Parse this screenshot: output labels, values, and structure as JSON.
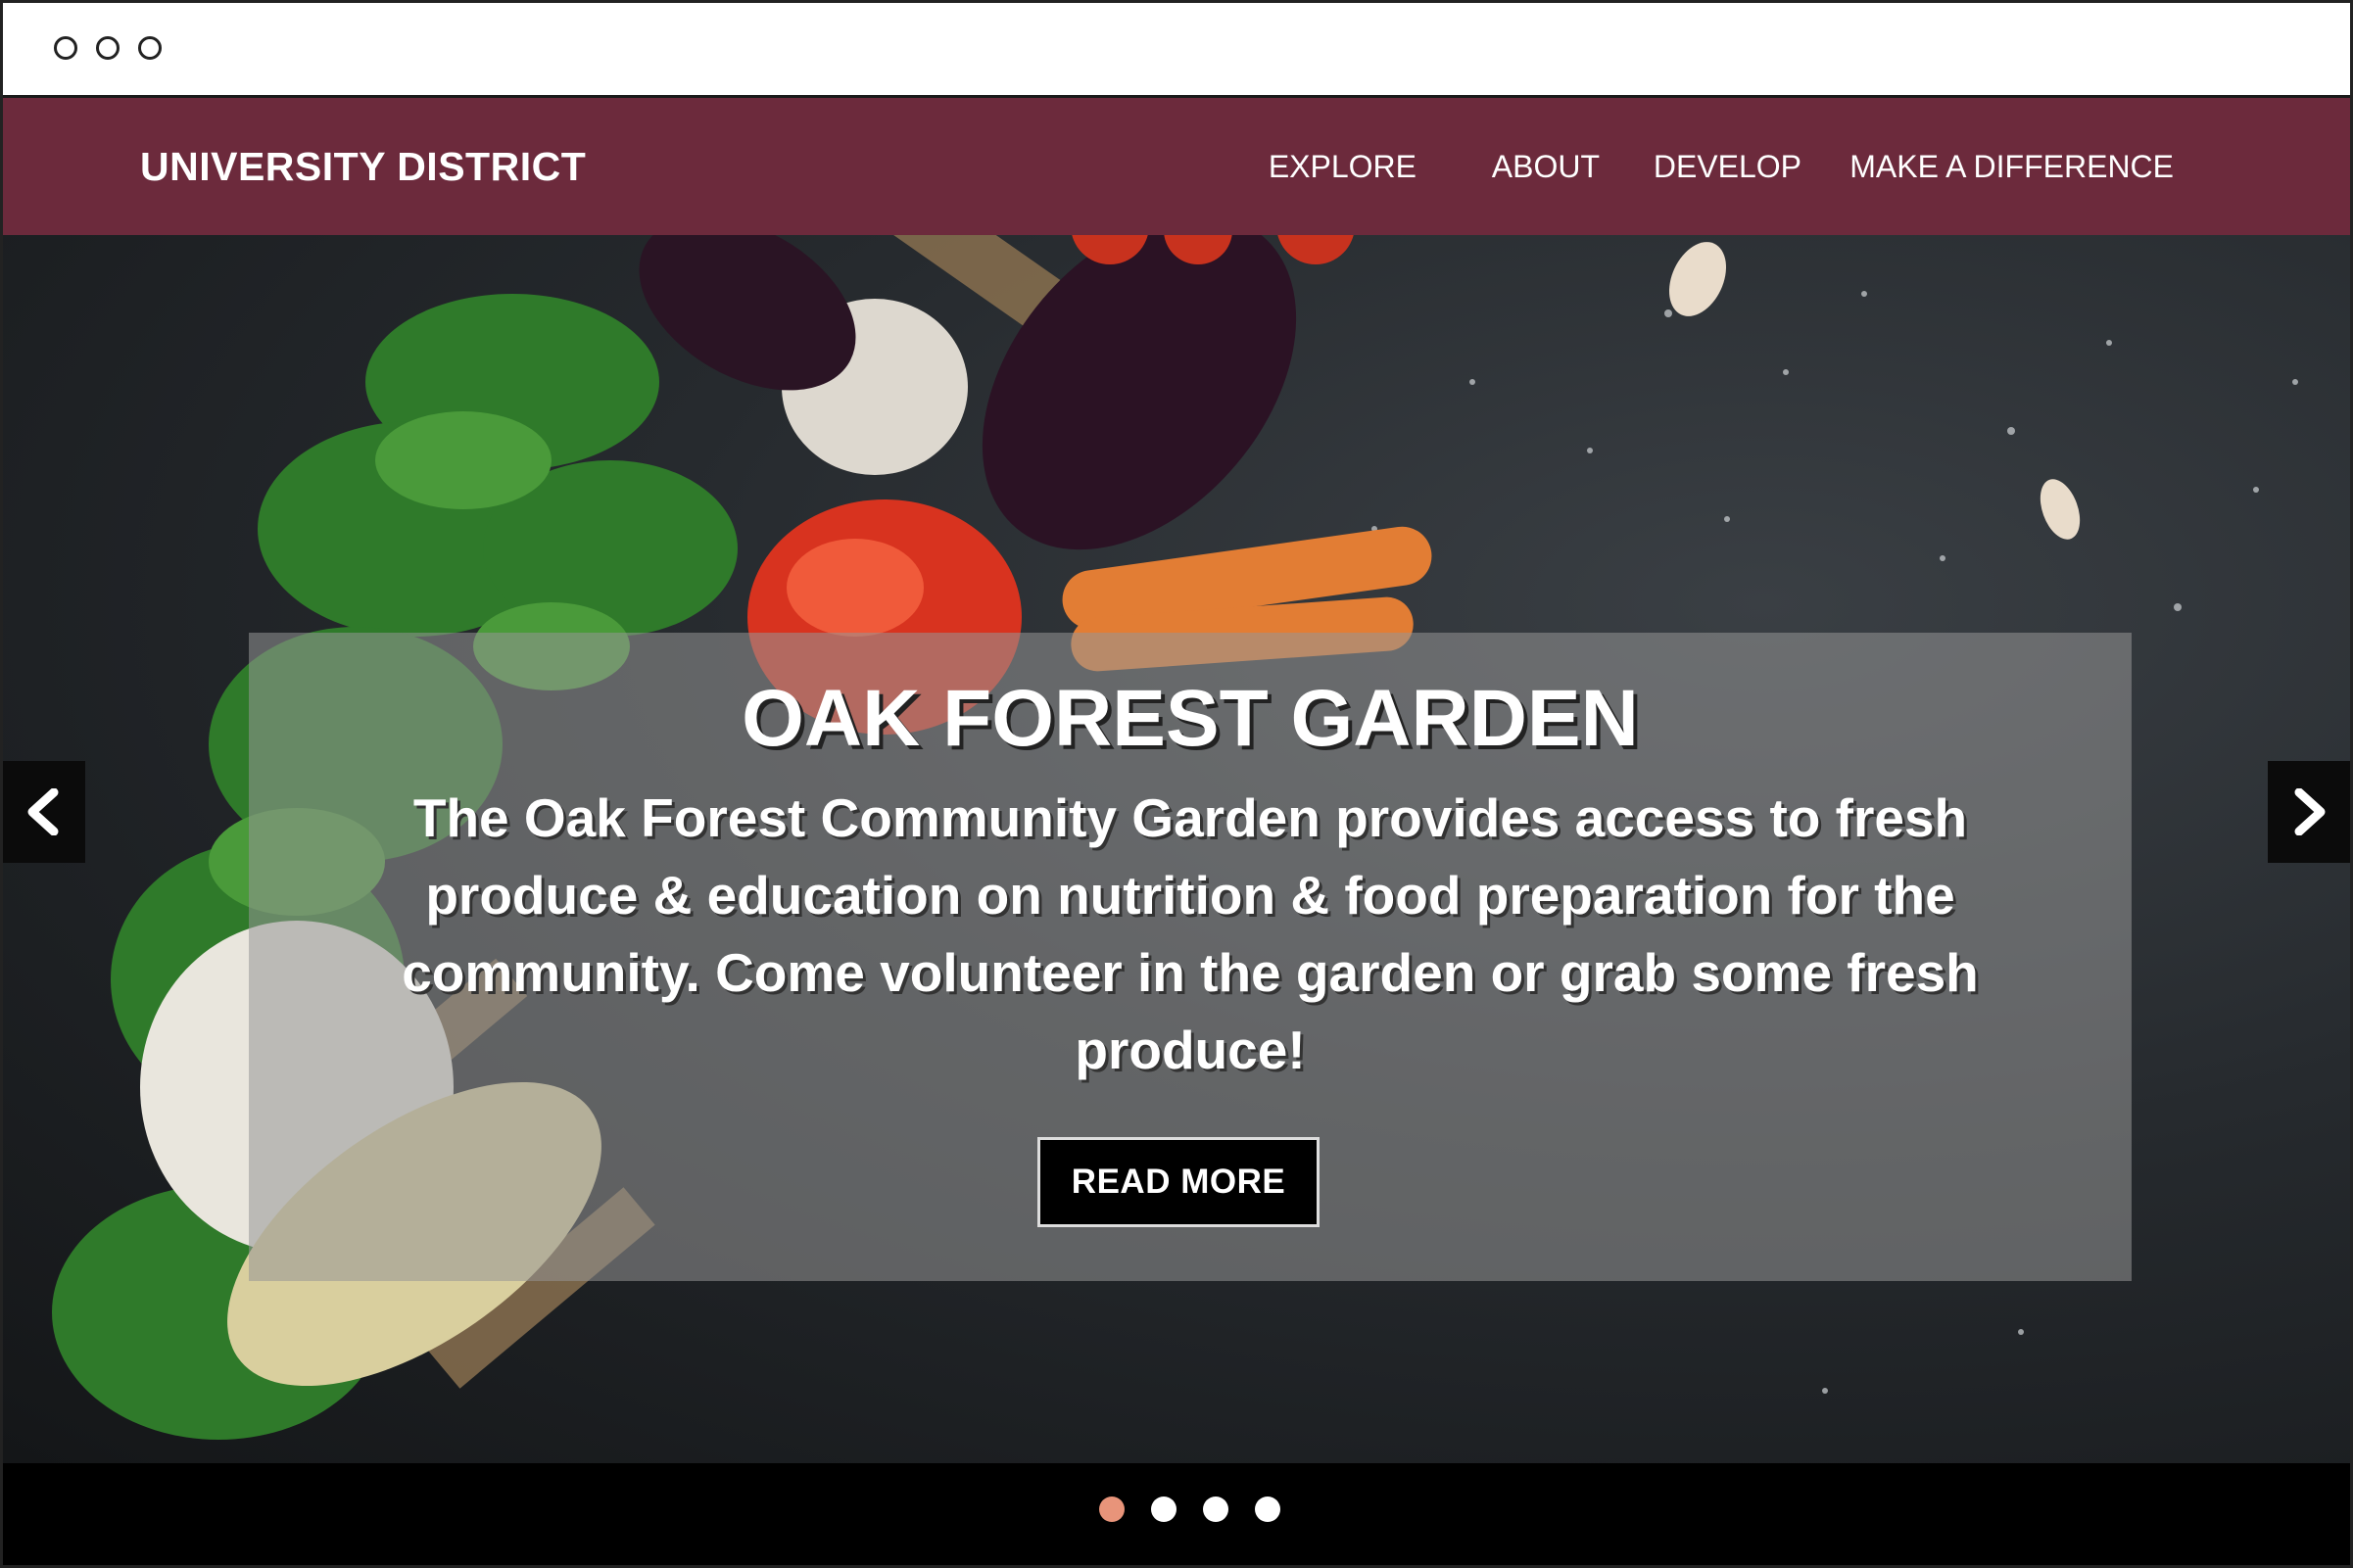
{
  "navbar": {
    "brand": "UNIVERSITY DISTRICT",
    "items": [
      "EXPLORE",
      "ABOUT",
      "DEVELOP",
      "MAKE A DIFFERENCE"
    ],
    "background_color": "#6c2a3c"
  },
  "hero": {
    "title": "OAK FOREST GARDEN",
    "text": "The Oak Forest Community Garden provides access to fresh produce & education on nutrition & food preparation for the community. Come volunteer in the garden or grab some fresh produce!",
    "button_label": "READ MORE"
  },
  "carousel": {
    "prev_icon": "chevron-left-icon",
    "next_icon": "chevron-right-icon",
    "slides_total": 4,
    "active_slide": 1,
    "active_color": "#e8947a",
    "inactive_color": "#ffffff"
  }
}
